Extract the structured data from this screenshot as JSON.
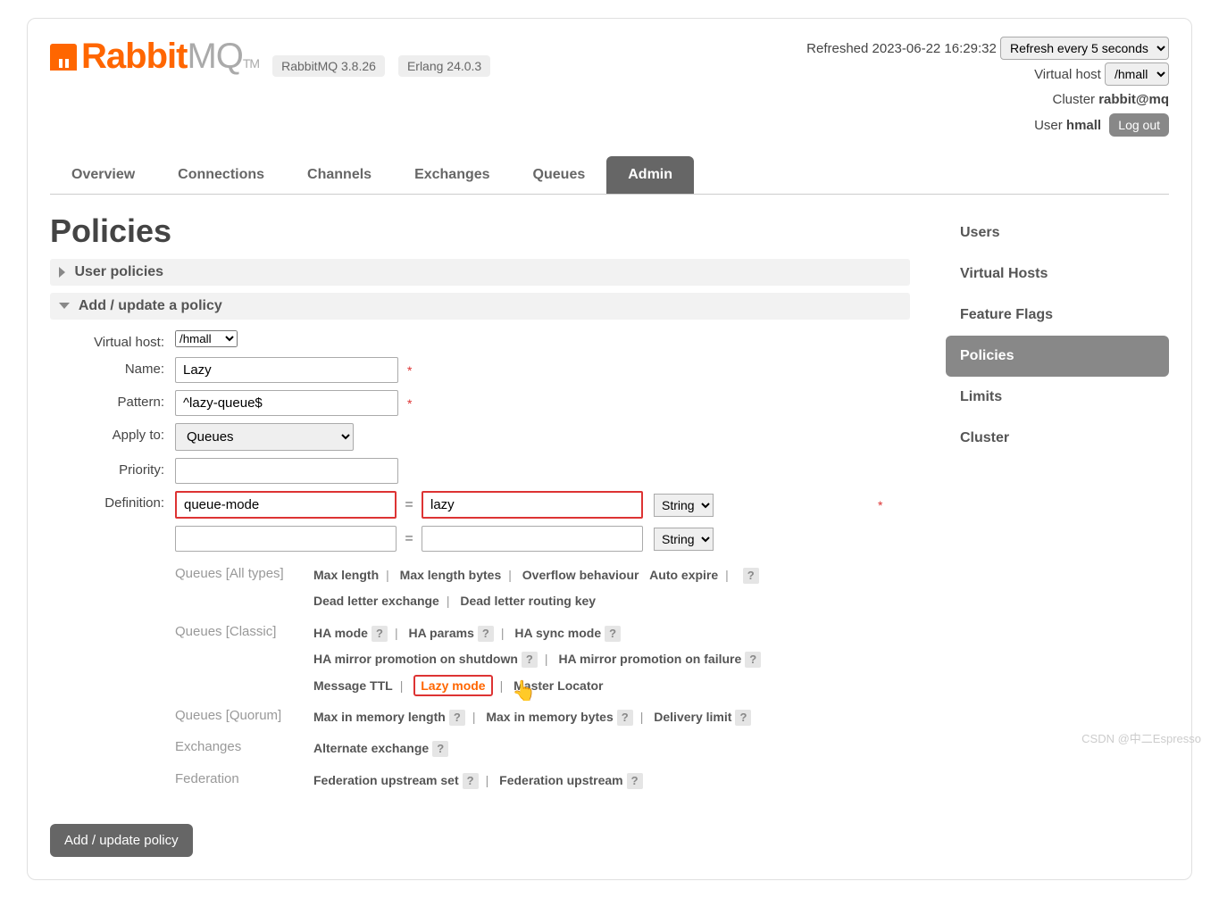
{
  "logo": {
    "rabbit": "Rabbit",
    "mq": "MQ",
    "tm": "TM"
  },
  "versions": {
    "rmq": "RabbitMQ 3.8.26",
    "erlang": "Erlang 24.0.3"
  },
  "refresh": {
    "label": "Refreshed",
    "timestamp": "2023-06-22 16:29:32",
    "interval": "Refresh every 5 seconds"
  },
  "vhost": {
    "label": "Virtual host",
    "value": "/hmall"
  },
  "cluster": {
    "label": "Cluster",
    "value": "rabbit@mq"
  },
  "user": {
    "label": "User",
    "value": "hmall",
    "logout": "Log out"
  },
  "nav": {
    "overview": "Overview",
    "connections": "Connections",
    "channels": "Channels",
    "exchanges": "Exchanges",
    "queues": "Queues",
    "admin": "Admin"
  },
  "side": {
    "users": "Users",
    "vhosts": "Virtual Hosts",
    "flags": "Feature Flags",
    "policies": "Policies",
    "limits": "Limits",
    "cluster": "Cluster"
  },
  "title": "Policies",
  "section1": "User policies",
  "section2": "Add / update a policy",
  "form": {
    "vhost": {
      "label": "Virtual host:",
      "value": "/hmall"
    },
    "name": {
      "label": "Name:",
      "value": "Lazy"
    },
    "pattern": {
      "label": "Pattern:",
      "value": "^lazy-queue$"
    },
    "apply": {
      "label": "Apply to:",
      "value": "Queues"
    },
    "priority": {
      "label": "Priority:",
      "value": ""
    },
    "definition": {
      "label": "Definition:",
      "key": "queue-mode",
      "val": "lazy",
      "type": "String",
      "type2": "String",
      "req": "*"
    }
  },
  "hints": {
    "all": {
      "label": "Queues [All types]",
      "items": [
        "Max length",
        "Max length bytes",
        "Overflow behaviour",
        "Auto expire",
        "Dead letter exchange",
        "Dead letter routing key"
      ]
    },
    "classic": {
      "label": "Queues [Classic]",
      "items": [
        "HA mode",
        "HA params",
        "HA sync mode",
        "HA mirror promotion on shutdown",
        "HA mirror promotion on failure",
        "Message TTL",
        "Lazy mode",
        "Master Locator"
      ]
    },
    "quorum": {
      "label": "Queues [Quorum]",
      "items": [
        "Max in memory length",
        "Max in memory bytes",
        "Delivery limit"
      ]
    },
    "ex": {
      "label": "Exchanges",
      "items": [
        "Alternate exchange"
      ]
    },
    "fed": {
      "label": "Federation",
      "items": [
        "Federation upstream set",
        "Federation upstream"
      ]
    }
  },
  "submit": "Add / update policy",
  "watermark": "CSDN @中二Espresso"
}
